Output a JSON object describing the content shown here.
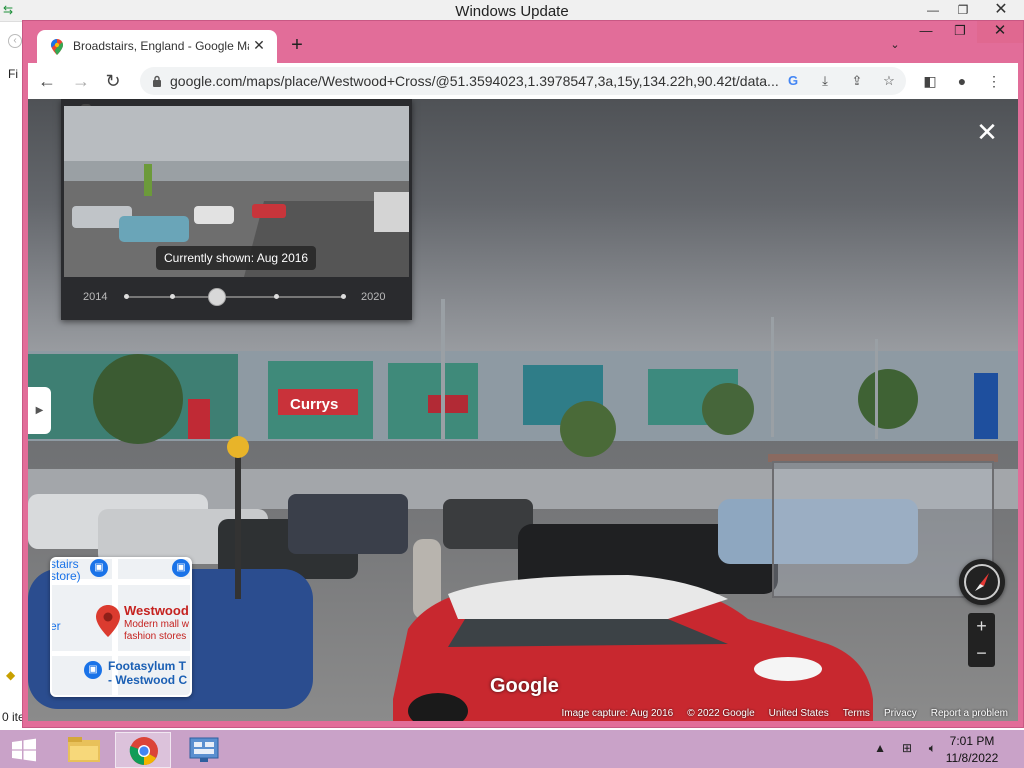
{
  "background_window": {
    "title": "Windows Update",
    "menu_letter": "Fi",
    "status_text": "0 ite"
  },
  "browser": {
    "tab": {
      "title": "Broadstairs, England - Google Ma",
      "favicon": "google-maps-pin-icon"
    },
    "url": "google.com/maps/place/Westwood+Cross/@51.3594023,1.3978547,3a,15y,134.22h,90.42t/data...",
    "accent_color": "#e26d99"
  },
  "streetview": {
    "time_travel": {
      "tooltip": "Currently shown: Aug 2016",
      "year_start": "2014",
      "year_end": "2020",
      "selected_index": 2,
      "dot_count": 5
    },
    "minimap": {
      "label_top_left": "stairs",
      "label_store": "store)",
      "label_er": "er",
      "place_name": "Westwood",
      "place_desc_1": "Modern mall w",
      "place_desc_2": "fashion stores",
      "poi_1_line1": "Footasylum T",
      "poi_1_line2": "- Westwood C"
    },
    "store_sign": "Currys",
    "logo_text": "Google",
    "footer": {
      "capture": "Image capture: Aug 2016",
      "copyright": "© 2022 Google",
      "country": "United States",
      "terms": "Terms",
      "privacy": "Privacy",
      "report": "Report a problem"
    },
    "zoom_in": "+",
    "zoom_out": "−"
  },
  "taskbar": {
    "time": "7:01 PM",
    "date": "11/8/2022"
  }
}
